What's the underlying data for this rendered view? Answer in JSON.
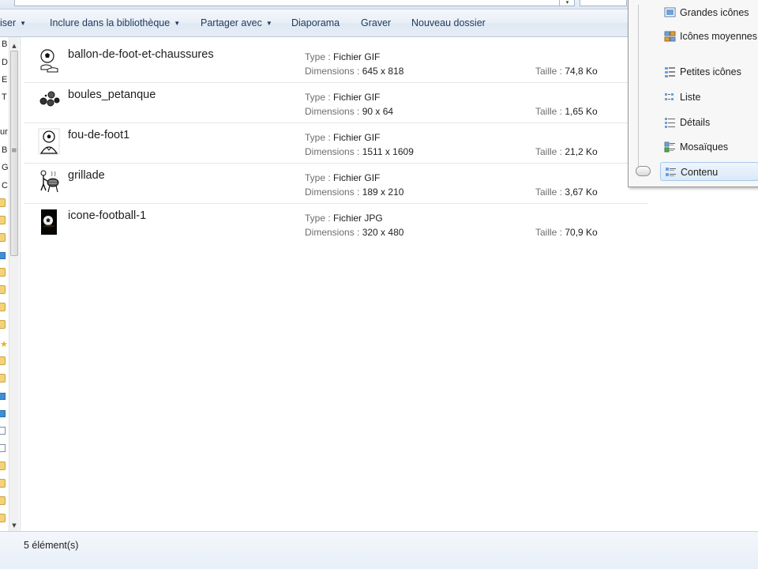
{
  "toolbar": {
    "organize_label": "iser",
    "include_label": "Inclure dans la bibliothèque",
    "share_label": "Partager avec",
    "slideshow_label": "Diaporama",
    "burn_label": "Graver",
    "new_folder_label": "Nouveau dossier"
  },
  "nav": {
    "letters": [
      "B",
      "D",
      "E",
      "T",
      "ur",
      "B",
      "G",
      "C"
    ]
  },
  "view_menu": {
    "items": [
      {
        "label": "Grandes icônes",
        "icon": "large-icons-icon"
      },
      {
        "label": "Icônes moyennes",
        "icon": "medium-icons-icon"
      },
      {
        "label": "Petites icônes",
        "icon": "small-icons-icon"
      },
      {
        "label": "Liste",
        "icon": "list-icon"
      },
      {
        "label": "Détails",
        "icon": "details-icon"
      },
      {
        "label": "Mosaïques",
        "icon": "tiles-icon"
      },
      {
        "label": "Contenu",
        "icon": "content-icon",
        "selected": true
      }
    ]
  },
  "files": [
    {
      "name": "ballon-de-foot-et-chaussures",
      "type_label": "Type :",
      "type": "Fichier GIF",
      "dims_label": "Dimensions :",
      "dims": "645 x 818",
      "size_label": "Taille :",
      "size": "74,8 Ko",
      "thumb": "soccer-ball-shoes-thumb"
    },
    {
      "name": "boules_petanque",
      "type_label": "Type :",
      "type": "Fichier GIF",
      "dims_label": "Dimensions :",
      "dims": "90 x 64",
      "size_label": "Taille :",
      "size": "1,65 Ko",
      "thumb": "petanque-balls-thumb"
    },
    {
      "name": "fou-de-foot1",
      "type_label": "Type :",
      "type": "Fichier GIF",
      "dims_label": "Dimensions :",
      "dims": "1511 x 1609",
      "size_label": "Taille :",
      "size": "21,2 Ko",
      "thumb": "football-fan-thumb"
    },
    {
      "name": "grillade",
      "type_label": "Type :",
      "type": "Fichier GIF",
      "dims_label": "Dimensions :",
      "dims": "189 x 210",
      "size_label": "Taille :",
      "size": "3,67 Ko",
      "thumb": "barbecue-thumb"
    },
    {
      "name": "icone-football-1",
      "type_label": "Type :",
      "type": "Fichier JPG",
      "dims_label": "Dimensions :",
      "dims": "320 x 480",
      "size_label": "Taille :",
      "size": "70,9 Ko",
      "thumb": "football-photo-thumb"
    }
  ],
  "status": {
    "item_count": "5 élément(s)"
  }
}
